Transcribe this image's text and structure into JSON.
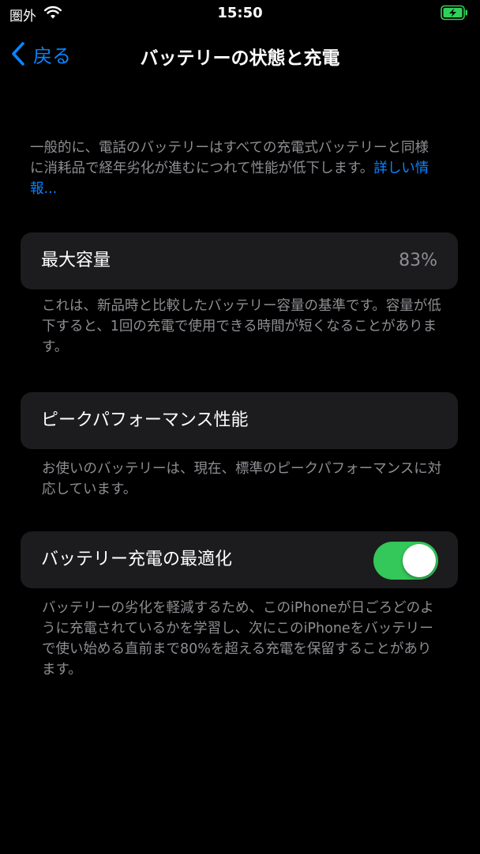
{
  "status_bar": {
    "carrier": "圏外",
    "time": "15:50",
    "wifi_icon": "wifi-icon",
    "battery_icon": "battery-charging-icon",
    "battery_color": "#30d158"
  },
  "nav": {
    "back_label": "戻る",
    "title": "バッテリーの状態と充電"
  },
  "intro": {
    "text": "一般的に、電話のバッテリーはすべての充電式バッテリーと同様に消耗品で経年劣化が進むにつれて性能が低下します。",
    "link": "詳しい情報..."
  },
  "max_capacity": {
    "label": "最大容量",
    "value": "83%",
    "note": "これは、新品時と比較したバッテリー容量の基準です。容量が低下すると、1回の充電で使用できる時間が短くなることがあります。"
  },
  "peak_performance": {
    "label": "ピークパフォーマンス性能",
    "note": "お使いのバッテリーは、現在、標準のピークパフォーマンスに対応しています。"
  },
  "optimized_charging": {
    "label": "バッテリー充電の最適化",
    "enabled": true,
    "note": "バッテリーの劣化を軽減するため、このiPhoneが日ごろどのように充電されているかを学習し、次にこのiPhoneをバッテリーで使い始める直前まで80%を超える充電を保留することがあります。"
  },
  "colors": {
    "background": "#000000",
    "card": "#1c1c1e",
    "secondary_text": "#8e8e93",
    "accent": "#0a84ff",
    "toggle_on": "#34c759"
  }
}
